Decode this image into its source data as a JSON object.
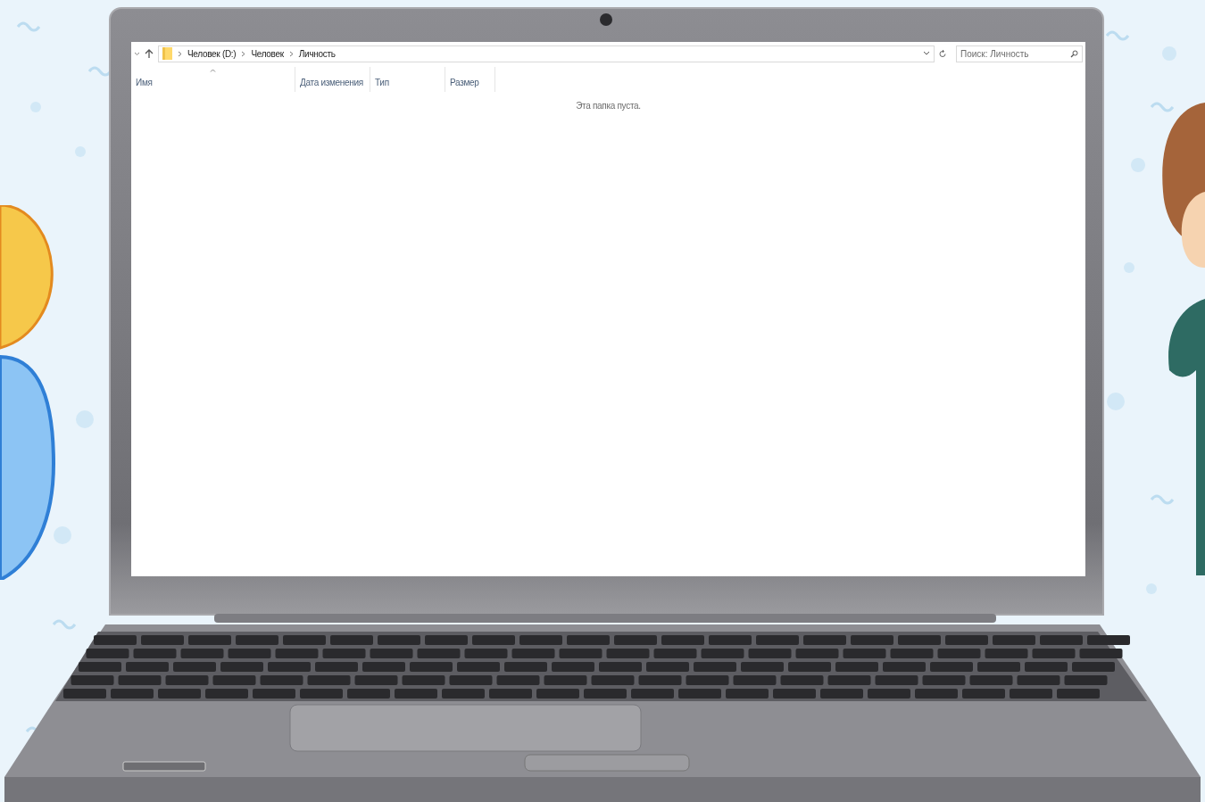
{
  "address_bar": {
    "breadcrumbs": [
      "Человек (D:)",
      "Человек",
      "Личность"
    ]
  },
  "search": {
    "placeholder": "Поиск: Личность"
  },
  "columns": [
    {
      "label": "Имя",
      "sorted": true
    },
    {
      "label": "Дата изменения",
      "sorted": false
    },
    {
      "label": "Тип",
      "sorted": false
    },
    {
      "label": "Размер",
      "sorted": false
    }
  ],
  "empty_message": "Эта папка пуста."
}
